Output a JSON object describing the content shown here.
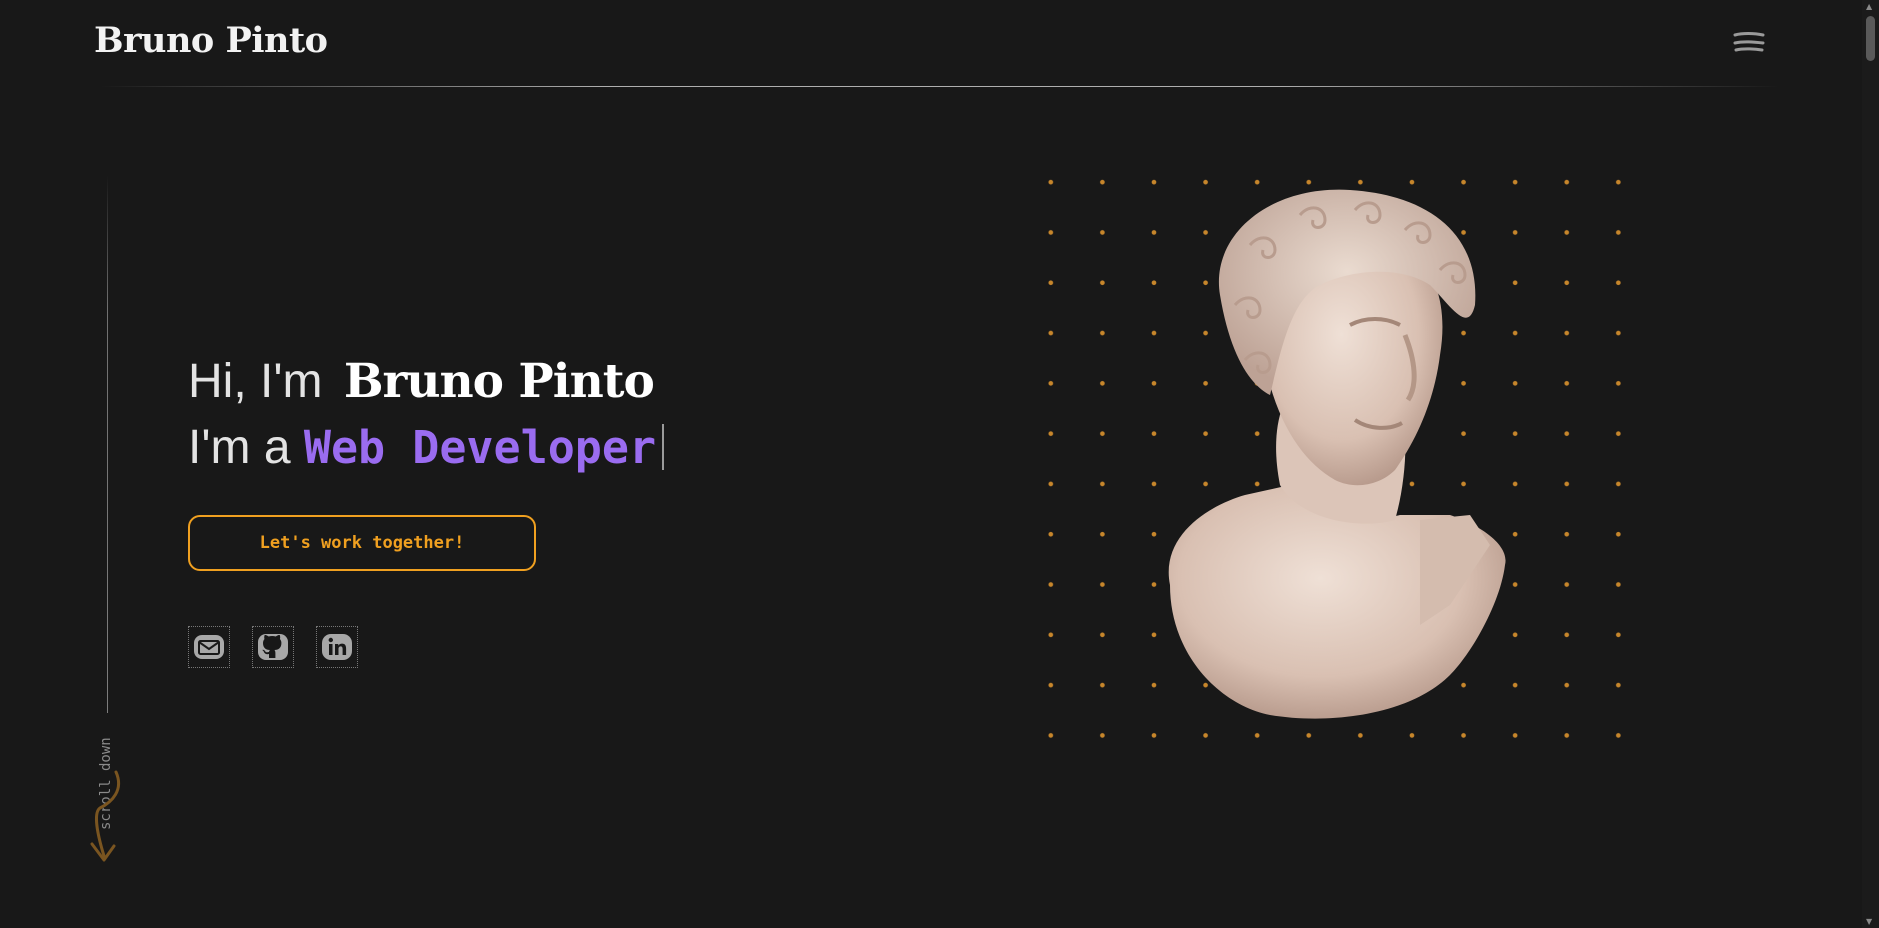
{
  "header": {
    "brand": "Bruno Pinto",
    "menu_icon": "menu-icon"
  },
  "hero": {
    "greeting": "Hi, I'm",
    "name": "Bruno Pinto",
    "role_prefix": "I'm a",
    "role": "Web Developer",
    "cta_label": "Let's work together!",
    "socials": [
      {
        "name": "email",
        "icon": "mail-icon"
      },
      {
        "name": "github",
        "icon": "github-icon"
      },
      {
        "name": "linkedin",
        "icon": "linkedin-icon"
      }
    ]
  },
  "side": {
    "scroll_hint": "scroll down"
  },
  "colors": {
    "background": "#181818",
    "accent_orange": "#f0a020",
    "highlight_brown": "#8a5a1c",
    "role_purple": "#9a6cf0",
    "dots": "#c7862b"
  }
}
